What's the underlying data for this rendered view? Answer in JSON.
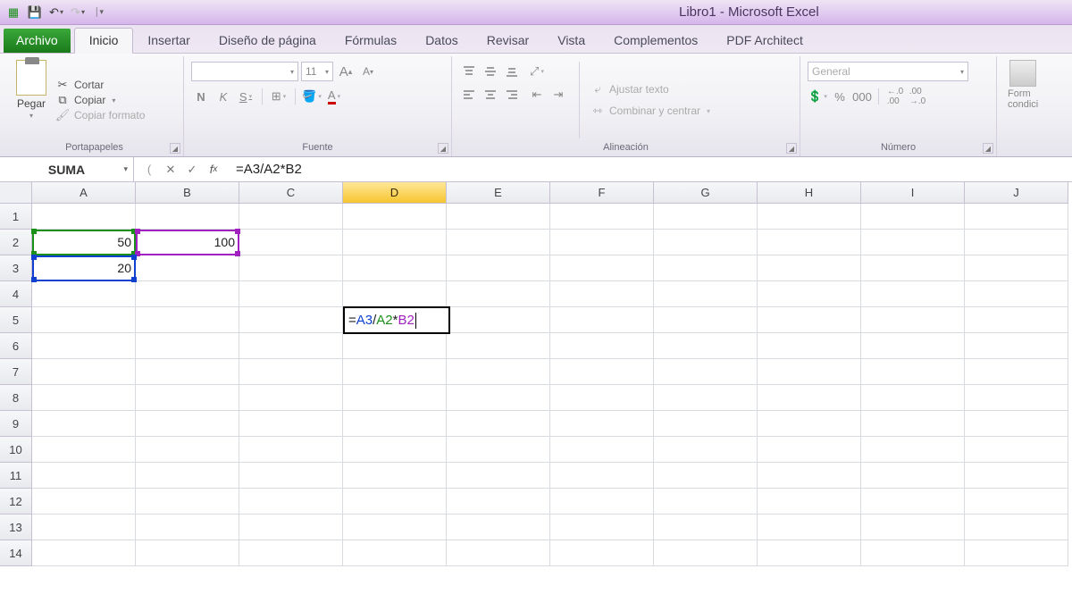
{
  "titlebar": {
    "title_doc": "Libro1",
    "title_app": "Microsoft Excel",
    "full_title": "Libro1 - Microsoft Excel"
  },
  "tabs": {
    "file": "Archivo",
    "items": [
      "Inicio",
      "Insertar",
      "Diseño de página",
      "Fórmulas",
      "Datos",
      "Revisar",
      "Vista",
      "Complementos",
      "PDF Architect"
    ],
    "active_index": 0
  },
  "ribbon": {
    "clipboard": {
      "paste": "Pegar",
      "cut": "Cortar",
      "copy": "Copiar",
      "format_painter": "Copiar formato",
      "group": "Portapapeles"
    },
    "font": {
      "size": "11",
      "bold": "N",
      "italic": "K",
      "underline": "S",
      "group": "Fuente"
    },
    "alignment": {
      "wrap": "Ajustar texto",
      "merge": "Combinar y centrar",
      "group": "Alineación"
    },
    "number": {
      "format": "General",
      "group": "Número"
    },
    "styles": {
      "cond": "Form\ncondici"
    }
  },
  "namebox": "SUMA",
  "formula": "=A3/A2*B2",
  "formula_parts": {
    "eq": "=",
    "a3": "A3",
    "sl": "/",
    "a2": "A2",
    "st": "*",
    "b2": "B2"
  },
  "columns": [
    "A",
    "B",
    "C",
    "D",
    "E",
    "F",
    "G",
    "H",
    "I",
    "J"
  ],
  "active_col_index": 3,
  "row_count": 14,
  "cells": {
    "A2": "50",
    "B2": "100",
    "A3": "20"
  },
  "chart_data": {
    "type": "table",
    "columns": [
      "A",
      "B"
    ],
    "rows": [
      {
        "A": 50,
        "B": 100
      },
      {
        "A": 20,
        "B": null
      }
    ],
    "formula_cell": {
      "addr": "D5",
      "formula": "=A3/A2*B2"
    }
  }
}
